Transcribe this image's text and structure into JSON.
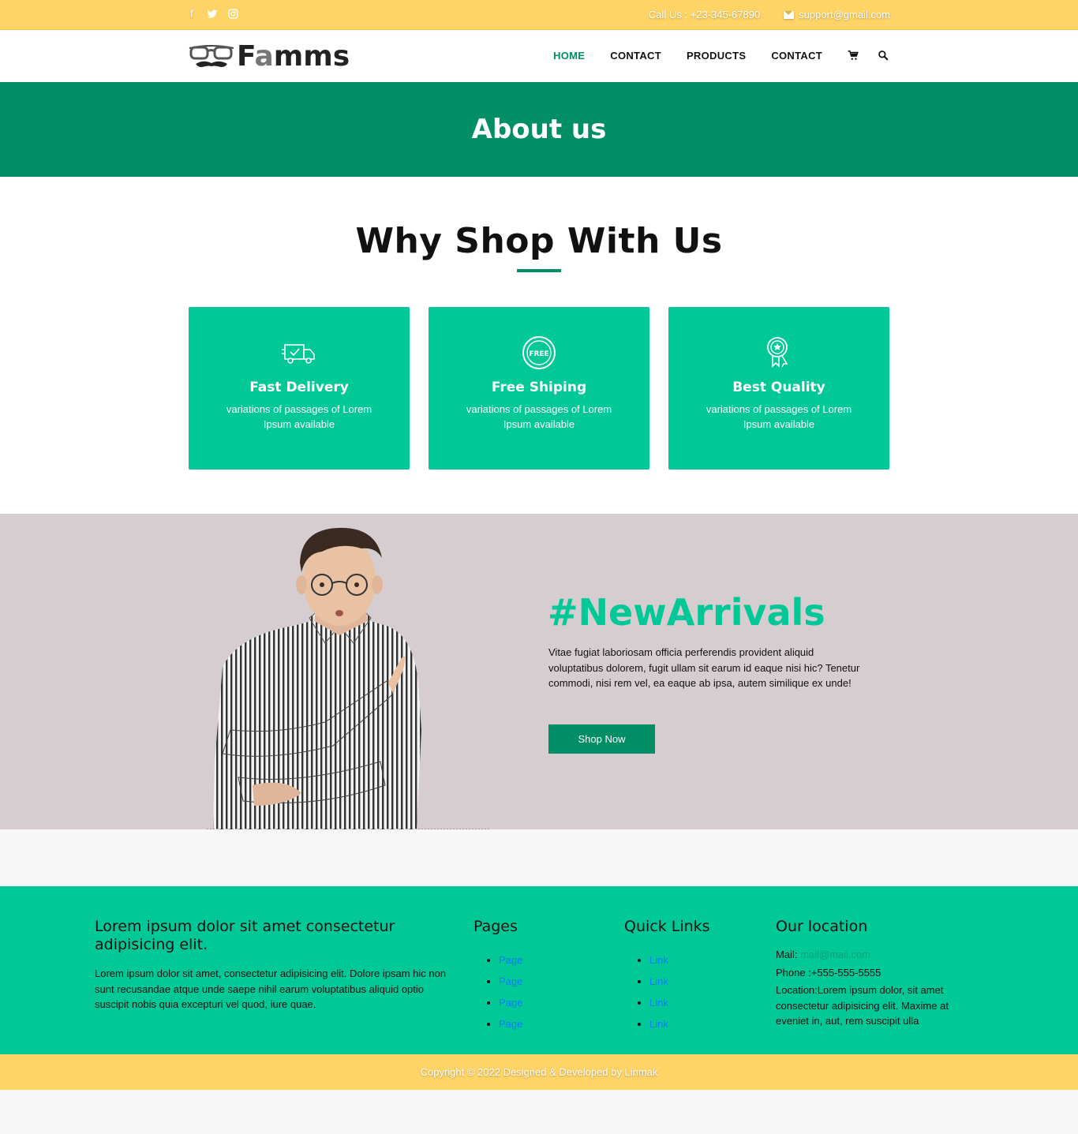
{
  "topbar": {
    "social": [
      "facebook-icon",
      "twitter-icon",
      "instagram-icon"
    ],
    "call": "Call Us : +23-345-67890",
    "email": "support@gmail.com"
  },
  "header": {
    "logo_text_1": "F",
    "logo_text_2": "a",
    "logo_text_3": "mms",
    "nav": [
      "HOME",
      "CONTACT",
      "PRODUCTS",
      "CONTACT"
    ],
    "icons": [
      "cart-icon",
      "search-icon"
    ]
  },
  "banner": {
    "title": "About us"
  },
  "why": {
    "title": "Why Shop With Us",
    "cards": [
      {
        "icon": "delivery-truck-icon",
        "title": "Fast Delivery",
        "text": "variations of passages of Lorem Ipsum available"
      },
      {
        "icon": "free-badge-icon",
        "title": "Free Shiping",
        "text": "variations of passages of Lorem Ipsum available"
      },
      {
        "icon": "quality-medal-icon",
        "title": "Best Quality",
        "text": "variations of passages of Lorem Ipsum available"
      }
    ]
  },
  "arrivals": {
    "title": "#NewArrivals",
    "text": "Vitae fugiat laboriosam officia perferendis provident aliquid voluptatibus dolorem, fugit ullam sit earum id eaque nisi hic? Tenetur commodi, nisi rem vel, ea eaque ab ipsa, autem similique ex unde!",
    "button": "Shop Now"
  },
  "footer": {
    "about_title": "Lorem ipsum dolor sit amet consectetur adipisicing elit.",
    "about_text": "Lorem ipsum dolor sit amet, consectetur adipisicing elit. Dolore ipsam hic non sunt recusandae atque unde saepe nihil earum voluptatibus aliquid optio suscipit nobis quia excepturi vel quod, iure quae.",
    "pages_title": "Pages",
    "pages": [
      "Page",
      "Page",
      "Page",
      "Page"
    ],
    "links_title": "Quick Links",
    "links": [
      "Link",
      "Link",
      "Link",
      "Link"
    ],
    "location_title": "Our location",
    "mail_label": "Mail:",
    "mail_value": "mail@mail.com",
    "phone": "Phone :+555-555-5555",
    "location": "Location:Lorem ipsum dolor, sit amet consectetur adipisicing elit. Maxime at eveniet in, aut, rem suscipit ulla"
  },
  "copyright": "Copyright © 2022 Designed & Developed by Linmak",
  "colors": {
    "accent": "#008f64",
    "card": "#00c896",
    "topbar": "#ffd466",
    "arrivals_bg": "#d5cdcf"
  }
}
